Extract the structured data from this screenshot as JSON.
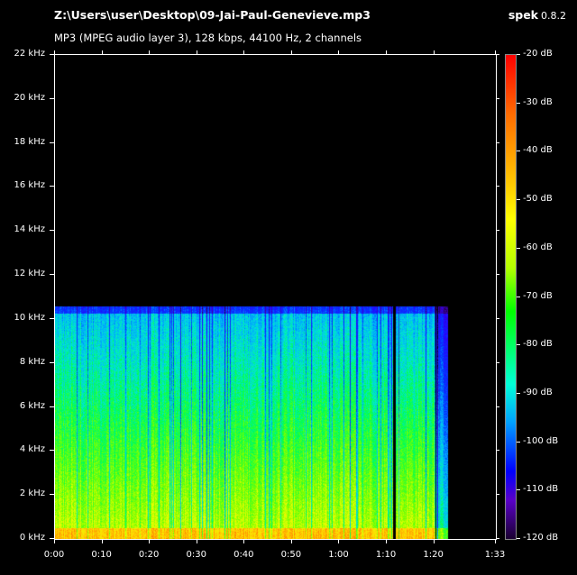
{
  "header": {
    "file_path": "Z:\\Users\\user\\Desktop\\09-Jai-Paul-Genevieve.mp3",
    "file_info": "MP3 (MPEG audio layer 3), 128 kbps, 44100 Hz, 2 channels",
    "app_name": "spek",
    "app_version": "0.8.2"
  },
  "colors": {
    "background": "#000000",
    "text": "#ffffff",
    "frame": "#ffffff"
  },
  "chart_data": {
    "type": "heatmap",
    "x_axis": {
      "unit": "time (m:ss)",
      "range_seconds": [
        0,
        93
      ],
      "tick_values_seconds": [
        0,
        10,
        20,
        30,
        40,
        50,
        60,
        70,
        80,
        93
      ],
      "tick_labels": [
        "0:00",
        "0:10",
        "0:20",
        "0:30",
        "0:40",
        "0:50",
        "1:00",
        "1:10",
        "1:20",
        "1:33"
      ]
    },
    "y_axis": {
      "unit": "kHz",
      "range": [
        0,
        22
      ],
      "tick_values": [
        0,
        2,
        4,
        6,
        8,
        10,
        12,
        14,
        16,
        18,
        20,
        22
      ],
      "tick_labels": [
        "0 kHz",
        "2 kHz",
        "4 kHz",
        "6 kHz",
        "8 kHz",
        "10 kHz",
        "12 kHz",
        "14 kHz",
        "16 kHz",
        "18 kHz",
        "20 kHz",
        "22 kHz"
      ]
    },
    "color_scale": {
      "unit": "dB",
      "range": [
        -120,
        -20
      ],
      "tick_values": [
        -20,
        -30,
        -40,
        -50,
        -60,
        -70,
        -80,
        -90,
        -100,
        -110,
        -120
      ],
      "tick_labels": [
        "-20 dB",
        "-30 dB",
        "-40 dB",
        "-50 dB",
        "-60 dB",
        "-70 dB",
        "-80 dB",
        "-90 dB",
        "-100 dB",
        "-110 dB",
        "-120 dB"
      ]
    },
    "audio_duration_seconds": 83,
    "frequency_cutoff_khz": 10.5,
    "legend": "right"
  }
}
